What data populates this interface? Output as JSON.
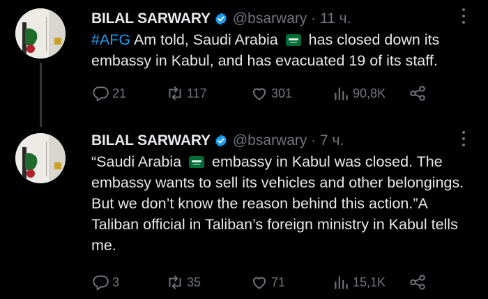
{
  "tweets": [
    {
      "author_name": "BILAL SARWARY",
      "handle_time": "@bsarwary · 11 ч.",
      "text": {
        "hashtag": "#AFG",
        "part1": " Am told, Saudi Arabia ",
        "part2": " has closed down its embassy in Kabul, and has evacuated 19 of its staff."
      },
      "stats": {
        "replies": "21",
        "retweets": "117",
        "likes": "301",
        "views": "90,8K"
      }
    },
    {
      "author_name": "BILAL SARWARY",
      "handle_time": "@bsarwary · 7 ч.",
      "text": {
        "part1": "“Saudi Arabia ",
        "part2": " embassy in Kabul was closed. The embassy wants to sell its vehicles and other belongings. But we don’t know the reason behind this action.”A Taliban official in Taliban’s foreign ministry in Kabul tells me."
      },
      "stats": {
        "replies": "3",
        "retweets": "35",
        "likes": "71",
        "views": "15,1K"
      }
    }
  ],
  "colors": {
    "background": "#000000",
    "text": "#e7e9ea",
    "muted": "#71767b",
    "accent": "#1d9bf0",
    "flag_green": "#006c35"
  },
  "icons": [
    "verified-icon",
    "more-icon",
    "reply-icon",
    "retweet-icon",
    "like-icon",
    "views-icon",
    "share-icon",
    "saudi-flag-icon"
  ]
}
